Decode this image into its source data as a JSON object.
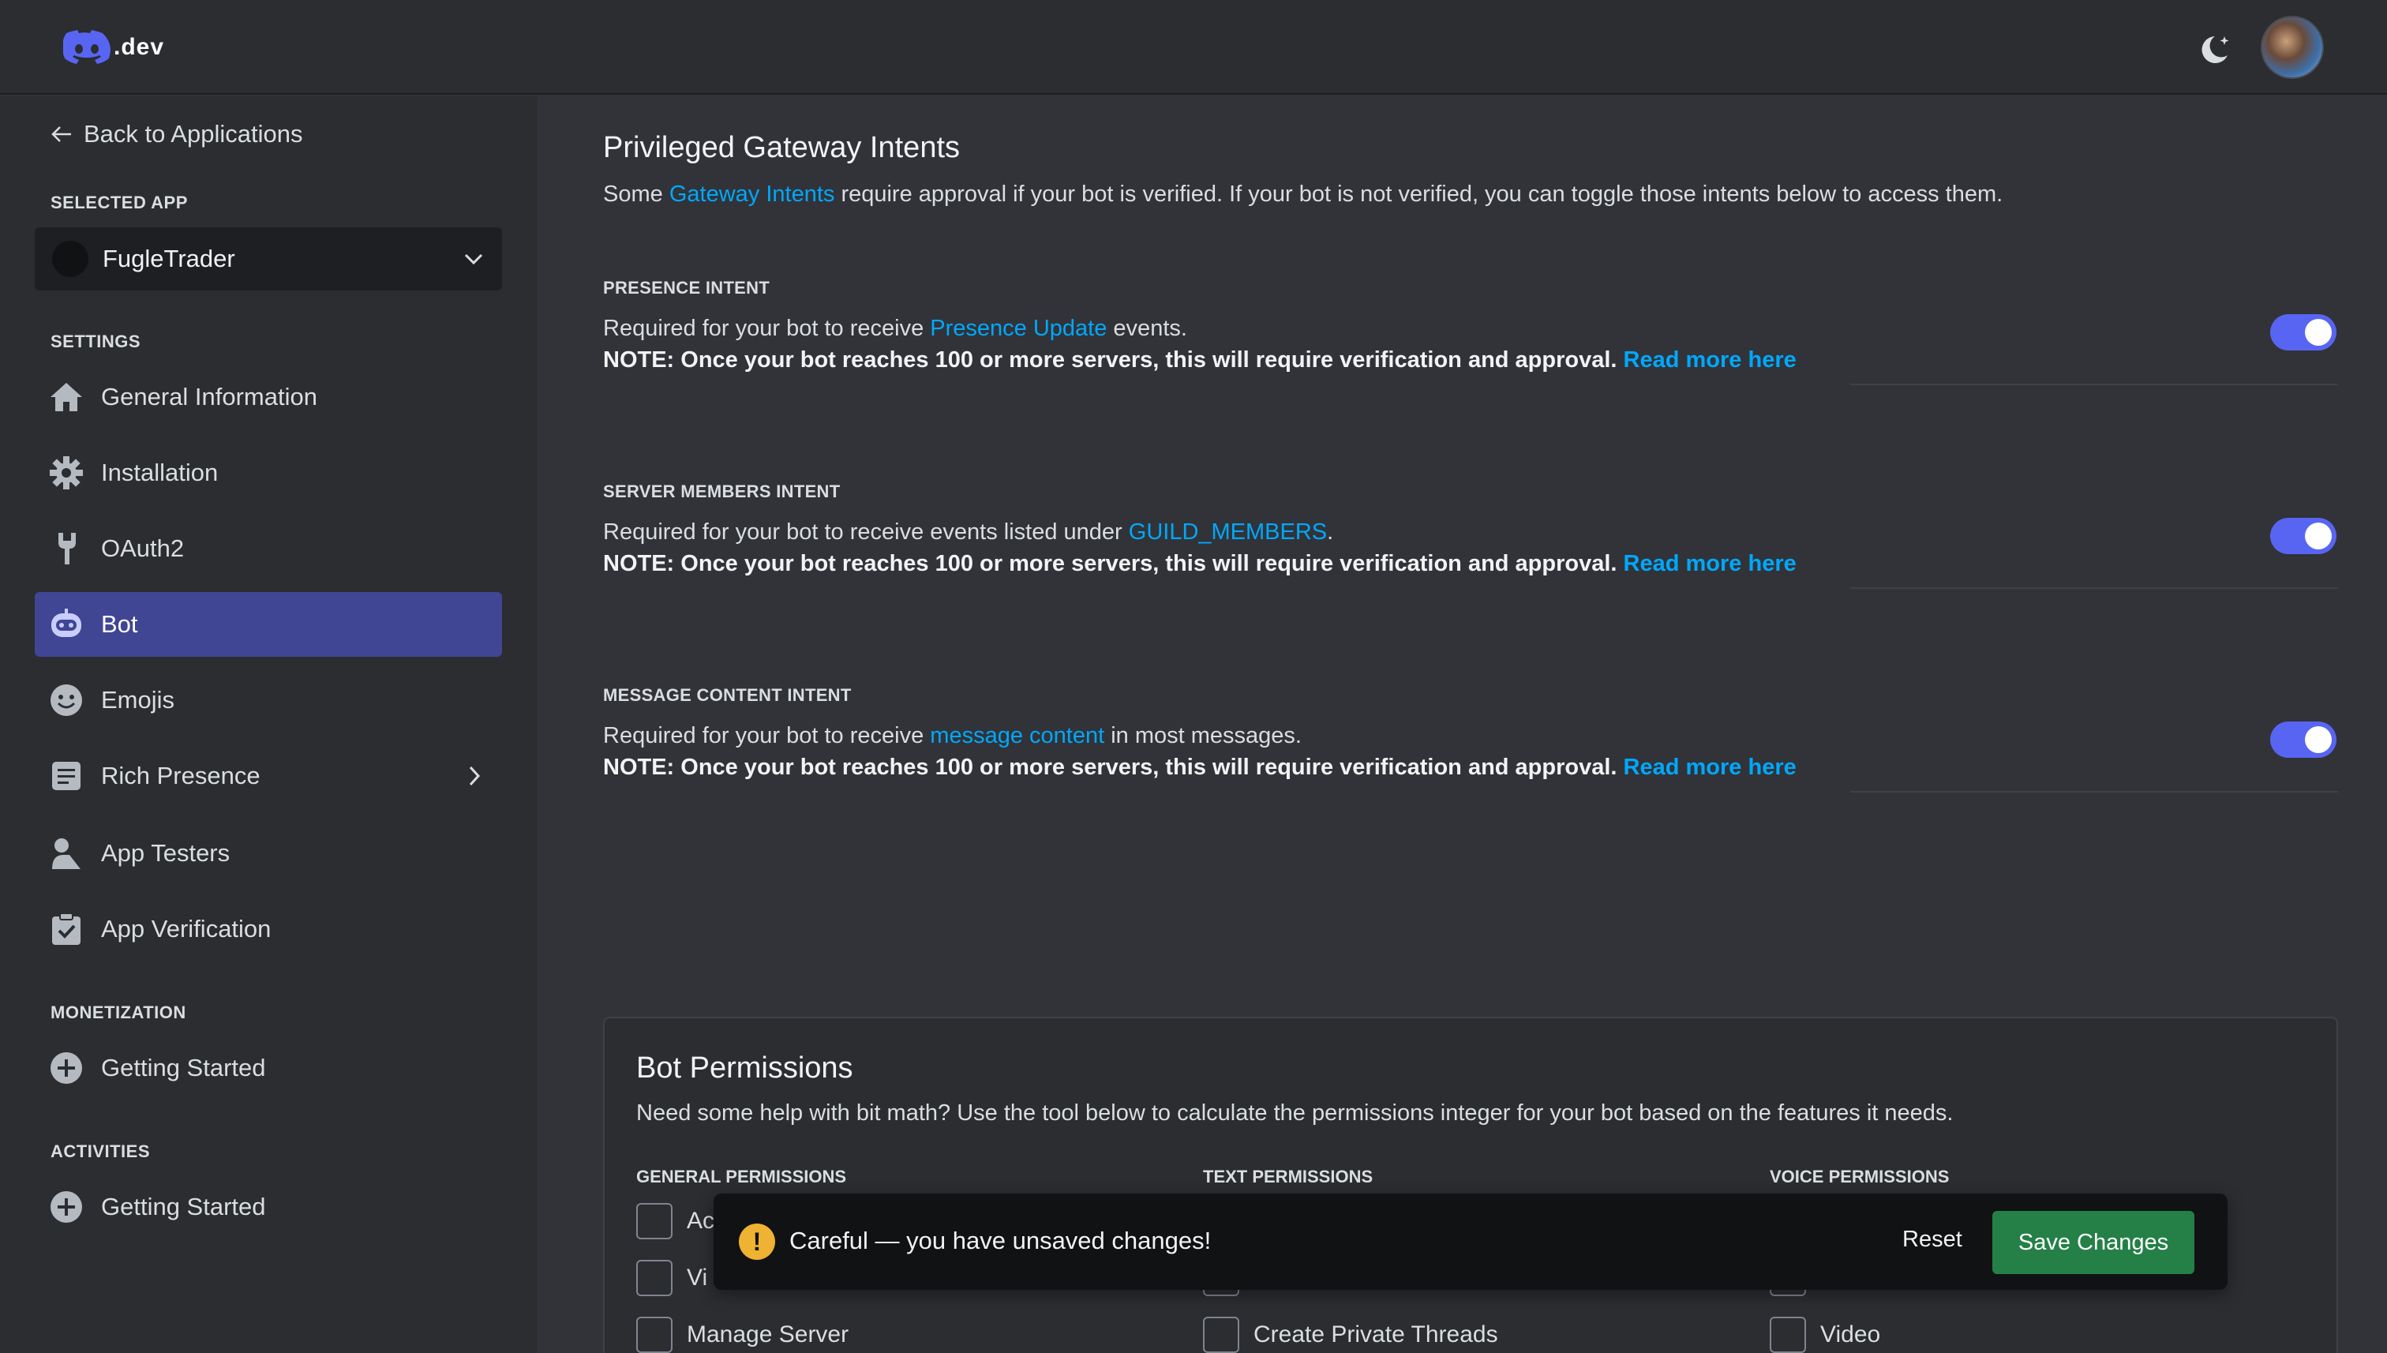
{
  "header": {
    "logo_text": ".dev",
    "theme_icon": "moon-star-icon",
    "avatar": "user-avatar"
  },
  "sidebar": {
    "back_label": "Back to Applications",
    "selected_app_label": "SELECTED APP",
    "selected_app_name": "FugleTrader",
    "settings_label": "SETTINGS",
    "settings_items": [
      {
        "label": "General Information",
        "icon": "home-icon"
      },
      {
        "label": "Installation",
        "icon": "gear-icon"
      },
      {
        "label": "OAuth2",
        "icon": "wrench-icon"
      },
      {
        "label": "Bot",
        "icon": "bot-icon",
        "active": true
      },
      {
        "label": "Emojis",
        "icon": "emoji-icon"
      },
      {
        "label": "Rich Presence",
        "icon": "document-icon"
      },
      {
        "label": "App Testers",
        "icon": "user-icon"
      },
      {
        "label": "App Verification",
        "icon": "clipboard-check-icon"
      }
    ],
    "monetization_label": "MONETIZATION",
    "monetization_items": [
      {
        "label": "Getting Started",
        "icon": "plus-circle-icon"
      }
    ],
    "activities_label": "ACTIVITIES",
    "activities_items": [
      {
        "label": "Getting Started",
        "icon": "plus-circle-icon"
      }
    ]
  },
  "main": {
    "title": "Privileged Gateway Intents",
    "desc_pre": "Some ",
    "desc_link": "Gateway Intents",
    "desc_post": " require approval if your bot is verified. If your bot is not verified, you can toggle those intents below to access them.",
    "note": "NOTE: Once your bot reaches 100 or more servers, this will require verification and approval.",
    "read_more": "Read more here",
    "intents": [
      {
        "label": "PRESENCE INTENT",
        "pre": "Required for your bot to receive ",
        "link": "Presence Update",
        "post": " events.",
        "enabled": true
      },
      {
        "label": "SERVER MEMBERS INTENT",
        "pre": "Required for your bot to receive events listed under ",
        "link": "GUILD_MEMBERS",
        "post": ".",
        "enabled": true
      },
      {
        "label": "MESSAGE CONTENT INTENT",
        "pre": "Required for your bot to receive ",
        "link": "message content",
        "post": " in most messages.",
        "enabled": true
      }
    ],
    "permissions": {
      "title": "Bot Permissions",
      "desc": "Need some help with bit math? Use the tool below to calculate the permissions integer for your bot based on the features it needs.",
      "general_label": "GENERAL PERMISSIONS",
      "text_label": "TEXT PERMISSIONS",
      "voice_label": "VOICE PERMISSIONS",
      "general_items": [
        "Ac",
        "Vi",
        "Manage Server"
      ],
      "text_items": [
        "Create Private Threads"
      ],
      "voice_items": [
        "Video"
      ]
    }
  },
  "unsaved": {
    "message": "Careful — you have unsaved changes!",
    "reset_label": "Reset",
    "save_label": "Save Changes"
  }
}
